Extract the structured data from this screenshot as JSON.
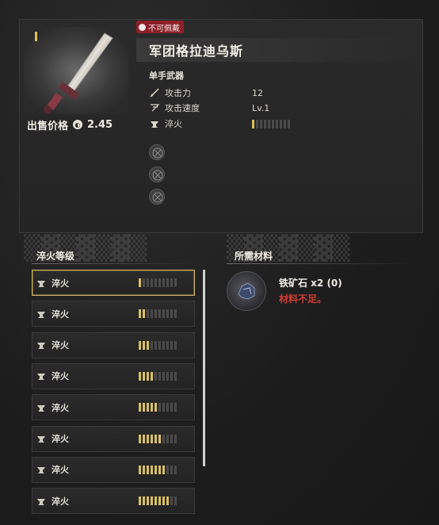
{
  "item": {
    "badge": "不可佩戴",
    "name": "军团格拉迪乌斯",
    "type": "单手武器",
    "sell_label": "出售价格",
    "sell_value": "2.45"
  },
  "stats": [
    {
      "label": "攻击力",
      "value": "12",
      "icon": "sword-icon"
    },
    {
      "label": "攻击速度",
      "value": "Lv.1",
      "icon": "speed-icon"
    },
    {
      "label": "淬火",
      "value": "",
      "icon": "anvil-icon",
      "level": 1,
      "max": 10
    }
  ],
  "slots": [
    "empty-slot-icon",
    "empty-slot-icon",
    "empty-slot-icon"
  ],
  "temper": {
    "title": "淬火等级",
    "rows": [
      {
        "label": "淬火",
        "level": 1,
        "max": 10,
        "selected": true
      },
      {
        "label": "淬火",
        "level": 2,
        "max": 10
      },
      {
        "label": "淬火",
        "level": 3,
        "max": 10
      },
      {
        "label": "淬火",
        "level": 4,
        "max": 10
      },
      {
        "label": "淬火",
        "level": 5,
        "max": 10
      },
      {
        "label": "淬火",
        "level": 6,
        "max": 10
      },
      {
        "label": "淬火",
        "level": 7,
        "max": 10
      },
      {
        "label": "淬火",
        "level": 8,
        "max": 10
      }
    ]
  },
  "materials": {
    "title": "所需材料",
    "items": [
      {
        "name": "铁矿石 x2 (0)",
        "status": "材料不足。",
        "icon": "iron-ore-icon"
      }
    ]
  },
  "colors": {
    "accent": "#d8c060",
    "warning": "#d23c32",
    "badge": "#8c2028"
  }
}
